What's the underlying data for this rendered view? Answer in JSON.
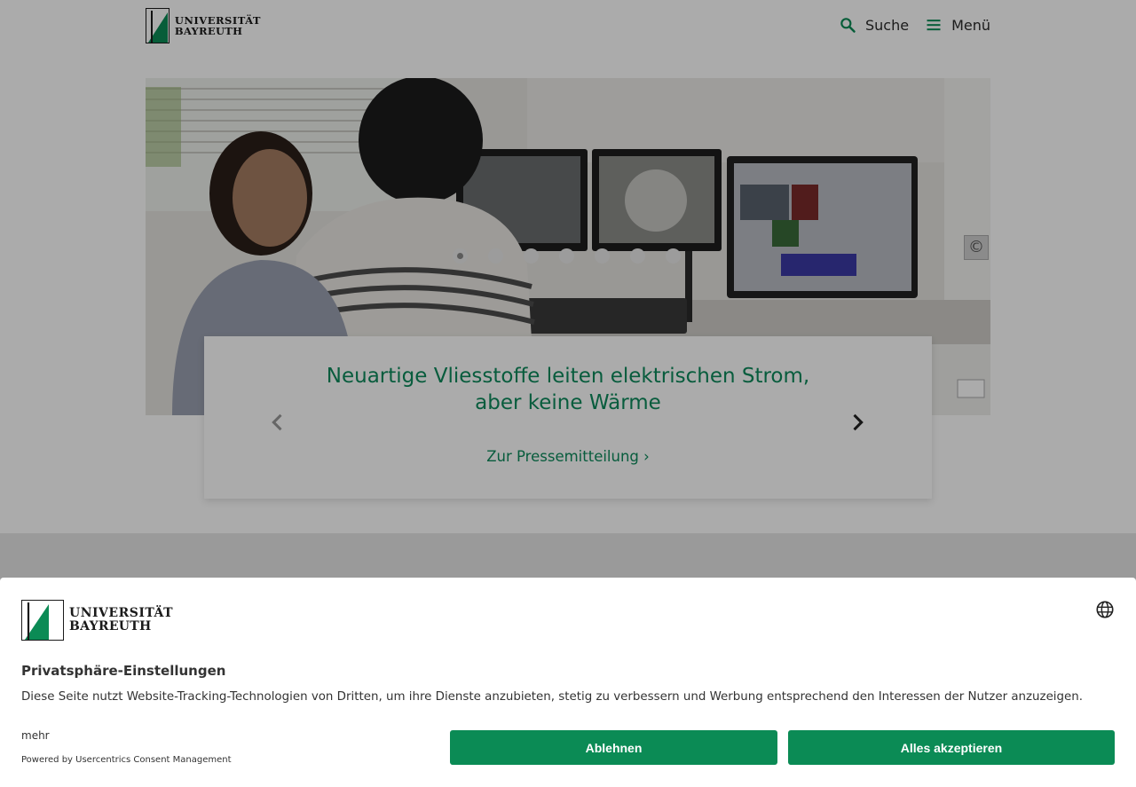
{
  "header": {
    "logo": {
      "line1": "UNIVERSITÄT",
      "line2": "BAYREUTH"
    },
    "search_label": "Suche",
    "menu_label": "Menü"
  },
  "hero": {
    "copyright_symbol": "©",
    "slide_count": 7,
    "active_slide": 1,
    "caption_title": "Neuartige Vliesstoffe leiten elektrischen Strom, aber keine Wärme",
    "caption_link": "Zur Pressemitteilung ›"
  },
  "consent": {
    "logo": {
      "line1": "UNIVERSITÄT",
      "line2": "BAYREUTH"
    },
    "title": "Privatsphäre-Einstellungen",
    "description": "Diese Seite nutzt Website-Tracking-Technologien von Dritten, um ihre Dienste anzubieten, stetig zu verbessern und Werbung entsprechend den Interessen der Nutzer anzuzeigen.",
    "more_label": "mehr",
    "powered_by": "Powered by Usercentrics Consent Management",
    "decline_label": "Ablehnen",
    "accept_label": "Alles akzeptieren"
  },
  "colors": {
    "brand_green": "#0b8b55",
    "link_green": "#0c8a5b"
  },
  "icons": [
    "search-icon",
    "menu-icon",
    "chevron-left-icon",
    "chevron-right-icon",
    "globe-icon",
    "copyright-icon"
  ]
}
